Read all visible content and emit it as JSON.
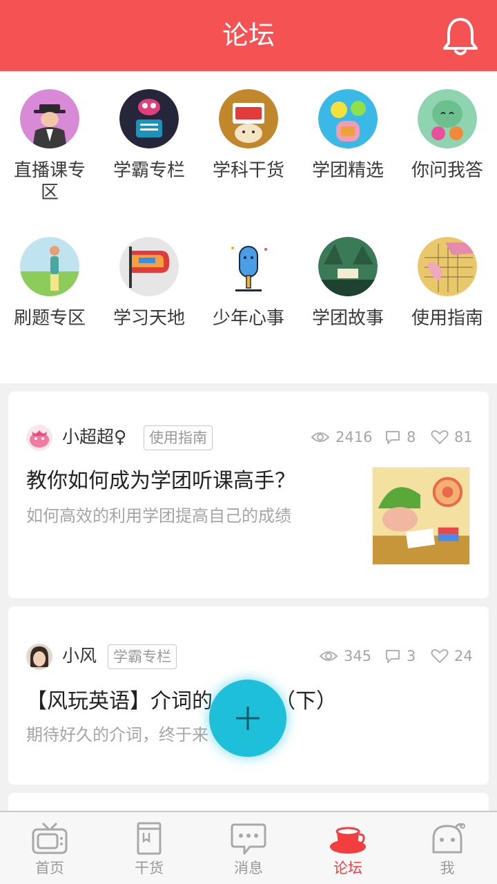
{
  "header": {
    "title": "论坛"
  },
  "categories": [
    {
      "label": "直播课专区",
      "icon": "live-class-icon"
    },
    {
      "label": "学霸专栏",
      "icon": "xueba-icon"
    },
    {
      "label": "学科干货",
      "icon": "subject-dry-goods-icon"
    },
    {
      "label": "学团精选",
      "icon": "featured-icon"
    },
    {
      "label": "你问我答",
      "icon": "qa-icon"
    },
    {
      "label": "刷题专区",
      "icon": "practice-icon"
    },
    {
      "label": "学习天地",
      "icon": "study-world-icon"
    },
    {
      "label": "少年心事",
      "icon": "popsicle-icon"
    },
    {
      "label": "学团故事",
      "icon": "story-icon"
    },
    {
      "label": "使用指南",
      "icon": "guide-icon"
    }
  ],
  "posts": [
    {
      "author": "小超超♀",
      "tag": "使用指南",
      "views": "2416",
      "comments": "8",
      "likes": "81",
      "title": "教你如何成为学团听课高手？",
      "subtitle": "如何高效的利用学团提高自己的成绩"
    },
    {
      "author": "小风",
      "tag": "学霸专栏",
      "views": "345",
      "comments": "3",
      "likes": "24",
      "title": "【风玩英语】介词的",
      "title_end": "（下）",
      "subtitle": "期待好久的介词，终于来"
    }
  ],
  "tabs": [
    {
      "label": "首页",
      "icon": "tv-icon"
    },
    {
      "label": "干货",
      "icon": "book-icon"
    },
    {
      "label": "消息",
      "icon": "chat-icon"
    },
    {
      "label": "论坛",
      "icon": "cup-icon",
      "active": true
    },
    {
      "label": "我",
      "icon": "ghost-icon"
    }
  ],
  "colors": {
    "header": "#f45253",
    "fab": "#1dbfd9",
    "active_tab": "#f23e3f"
  }
}
